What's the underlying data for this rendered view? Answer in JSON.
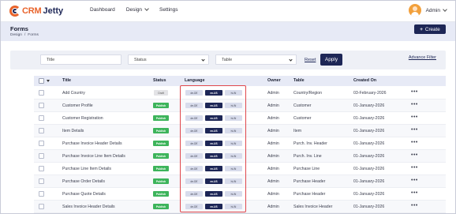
{
  "app": {
    "logo_part1": "CRM",
    "logo_part2": "Jetty"
  },
  "nav": [
    {
      "label": "Dashboard",
      "dropdown": false
    },
    {
      "label": "Design",
      "dropdown": true
    },
    {
      "label": "Settings",
      "dropdown": false
    }
  ],
  "user": {
    "name": "Admin"
  },
  "page": {
    "title": "Forms",
    "breadcrumb": [
      "Design",
      "Forms"
    ],
    "create_label": "Create"
  },
  "filters": {
    "title_placeholder": "Title",
    "status_label": "Status",
    "table_label": "Table",
    "reset_label": "Reset",
    "apply_label": "Apply",
    "advanced_label": "Advance Filter"
  },
  "table": {
    "columns": [
      "Title",
      "Status",
      "Language",
      "Owner",
      "Table",
      "Created On"
    ],
    "rows": [
      {
        "title": "Add Country",
        "status": "Draft",
        "langs": [
          "de-DE",
          "en-US",
          "hi-IN"
        ],
        "active_lang": 1,
        "owner": "Admin",
        "table": "Country/Region",
        "created": "03-February-2026"
      },
      {
        "title": "Customer Profile",
        "status": "Publish",
        "langs": [
          "de-DE",
          "en-US",
          "hi-IN"
        ],
        "active_lang": 1,
        "owner": "Admin",
        "table": "Customer",
        "created": "01-January-2026"
      },
      {
        "title": "Customer Registration",
        "status": "Publish",
        "langs": [
          "de-DE",
          "en-US",
          "hi-IN"
        ],
        "active_lang": 1,
        "owner": "Admin",
        "table": "Customer",
        "created": "01-January-2026"
      },
      {
        "title": "Item Details",
        "status": "Publish",
        "langs": [
          "de-DE",
          "en-US",
          "hi-IN"
        ],
        "active_lang": 1,
        "owner": "Admin",
        "table": "Item",
        "created": "01-January-2026"
      },
      {
        "title": "Purchase Invoice Header Details",
        "status": "Publish",
        "langs": [
          "de-DE",
          "en-US",
          "hi-IN"
        ],
        "active_lang": 1,
        "owner": "Admin",
        "table": "Purch. Inv. Header",
        "created": "01-January-2026"
      },
      {
        "title": "Purchase Invoice Line Item Details",
        "status": "Publish",
        "langs": [
          "de-DE",
          "en-US",
          "hi-IN"
        ],
        "active_lang": 1,
        "owner": "Admin",
        "table": "Purch. Inv. Line",
        "created": "01-January-2026"
      },
      {
        "title": "Purchase Line Item Details",
        "status": "Publish",
        "langs": [
          "de-DE",
          "en-US",
          "hi-IN"
        ],
        "active_lang": 1,
        "owner": "Admin",
        "table": "Purchase Line",
        "created": "01-January-2026"
      },
      {
        "title": "Purchase Order Details",
        "status": "Publish",
        "langs": [
          "de-DE",
          "en-US",
          "hi-IN"
        ],
        "active_lang": 1,
        "owner": "Admin",
        "table": "Purchase Header",
        "created": "01-January-2026"
      },
      {
        "title": "Purchase Quote Details",
        "status": "Publish",
        "langs": [
          "de-DE",
          "en-US",
          "hi-IN"
        ],
        "active_lang": 1,
        "owner": "Admin",
        "table": "Purchase Header",
        "created": "01-January-2026"
      },
      {
        "title": "Sales Invoice Header Details",
        "status": "Publish",
        "langs": [
          "de-DE",
          "en-US",
          "hi-IN"
        ],
        "active_lang": 1,
        "owner": "Admin",
        "table": "Sales Invoice Header",
        "created": "01-January-2026"
      }
    ],
    "row_action": "•••"
  },
  "colors": {
    "brand": "#1d2656",
    "accent": "#e8632b",
    "publish": "#3db45b",
    "highlight": "#e0474c"
  }
}
